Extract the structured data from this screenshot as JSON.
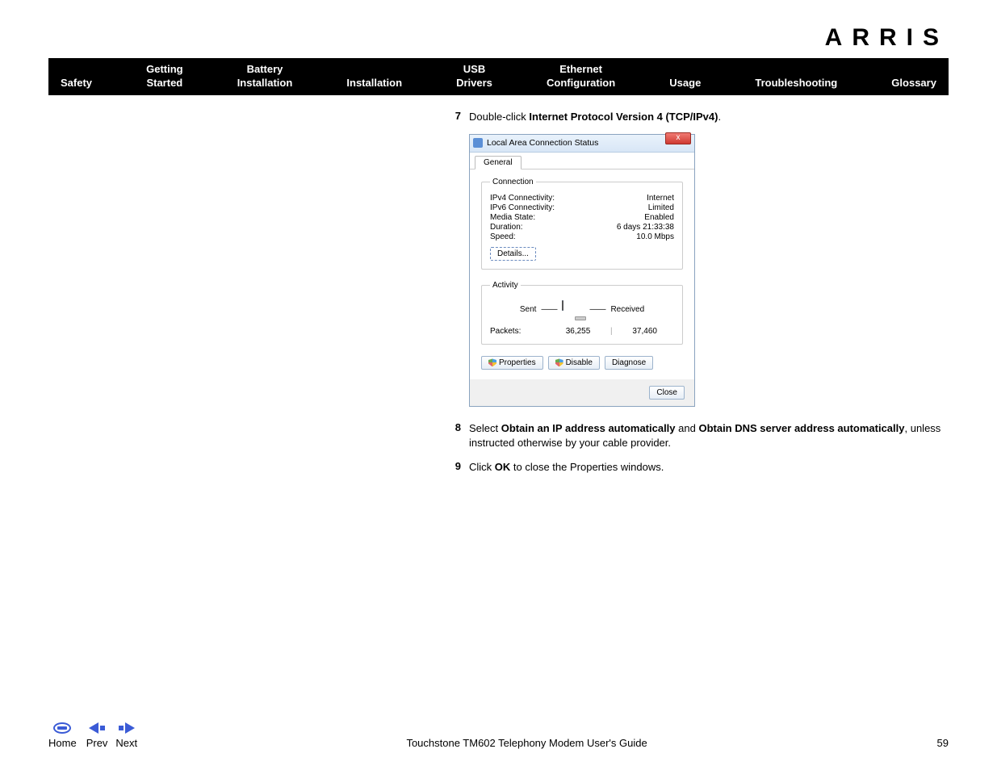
{
  "logo": "ARRIS",
  "nav": {
    "safety": "Safety",
    "getting1": "Getting",
    "getting2": "Started",
    "battery1": "Battery",
    "battery2": "Installation",
    "installation": "Installation",
    "usb1": "USB",
    "usb2": "Drivers",
    "eth1": "Ethernet",
    "eth2": "Configuration",
    "usage": "Usage",
    "troubleshooting": "Troubleshooting",
    "glossary": "Glossary"
  },
  "steps": {
    "s7": {
      "num": "7",
      "pre": "Double-click ",
      "bold": "Internet Protocol Version 4 (TCP/IPv4)",
      "post": "."
    },
    "s8": {
      "num": "8",
      "pre": "Select ",
      "bold1": "Obtain an IP address automatically",
      "mid": " and ",
      "bold2": "Obtain DNS server address automatically",
      "post": ", unless instructed otherwise by your cable provider."
    },
    "s9": {
      "num": "9",
      "pre": "Click ",
      "bold": "OK",
      "post": " to close the Properties windows."
    }
  },
  "dialog": {
    "title": "Local Area Connection Status",
    "close_x": "x",
    "tab_general": "General",
    "section_connection": "Connection",
    "rows": {
      "ipv4_l": "IPv4 Connectivity:",
      "ipv4_v": "Internet",
      "ipv6_l": "IPv6 Connectivity:",
      "ipv6_v": "Limited",
      "media_l": "Media State:",
      "media_v": "Enabled",
      "dur_l": "Duration:",
      "dur_v": "6 days 21:33:38",
      "speed_l": "Speed:",
      "speed_v": "10.0 Mbps"
    },
    "details_btn": "Details...",
    "section_activity": "Activity",
    "sent": "Sent",
    "received": "Received",
    "packets_l": "Packets:",
    "packets_sent": "36,255",
    "packets_recv": "37,460",
    "btn_properties": "Properties",
    "btn_disable": "Disable",
    "btn_diagnose": "Diagnose",
    "btn_close": "Close"
  },
  "footer": {
    "home": "Home",
    "prev": "Prev",
    "next": "Next",
    "title": "Touchstone TM602 Telephony Modem User's Guide",
    "page": "59"
  }
}
